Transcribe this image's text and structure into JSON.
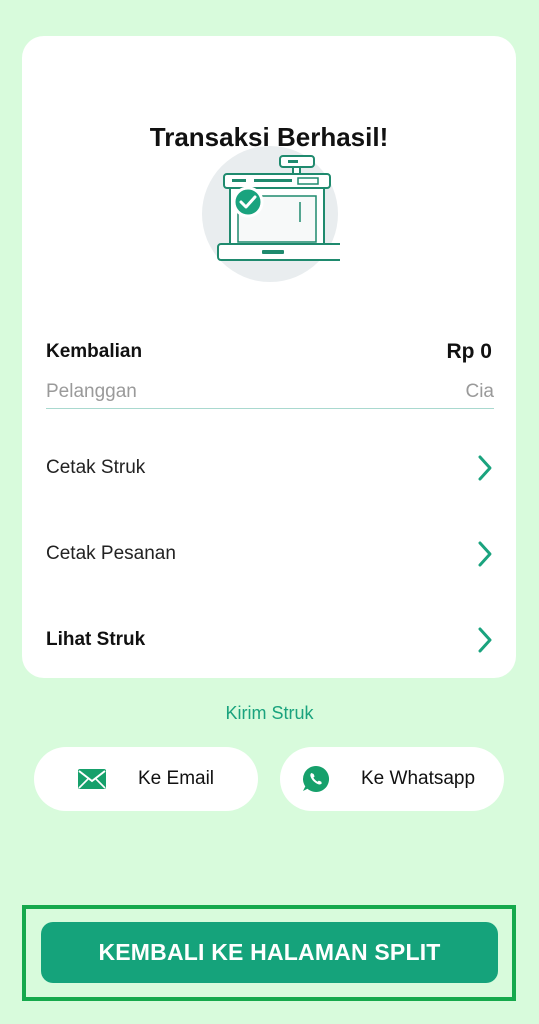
{
  "colors": {
    "background": "#d8fbdc",
    "accent": "#15a37b",
    "frame": "#15a94c",
    "divider": "#a9d9cf"
  },
  "card": {
    "title": "Transaksi Berhasil!",
    "illustration_icon": "cash-register-check-icon",
    "kembalian": {
      "label": "Kembalian",
      "value": "Rp 0"
    },
    "pelanggan": {
      "label": "Pelanggan",
      "value": "Cia"
    },
    "menu": [
      {
        "label": "Cetak Struk",
        "icon": "chevron-right-icon"
      },
      {
        "label": "Cetak Pesanan",
        "icon": "chevron-right-icon"
      },
      {
        "label": "Lihat Struk",
        "icon": "chevron-right-icon"
      }
    ]
  },
  "share": {
    "heading": "Kirim Struk",
    "email": {
      "label": "Ke Email",
      "icon": "email-icon"
    },
    "whatsapp": {
      "label": "Ke Whatsapp",
      "icon": "whatsapp-icon"
    }
  },
  "primary_button": {
    "label": "KEMBALI KE HALAMAN SPLIT"
  }
}
